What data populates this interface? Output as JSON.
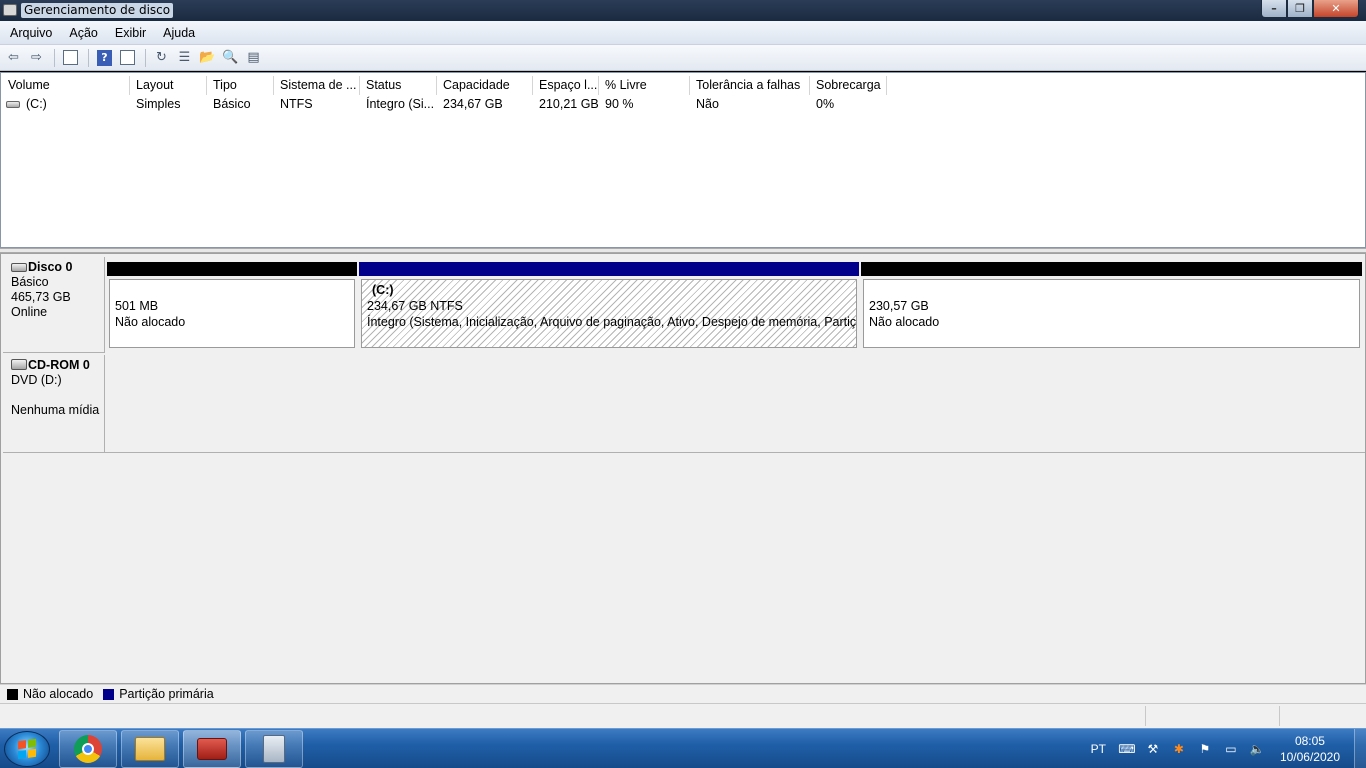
{
  "window": {
    "title": "Gerenciamento de disco",
    "min_glyph": "–",
    "max_glyph": "❐",
    "close_glyph": "✕"
  },
  "menu": [
    "Arquivo",
    "Ação",
    "Exibir",
    "Ajuda"
  ],
  "toolbar": {
    "back_icon": "back-arrow-icon",
    "forward_icon": "forward-arrow-icon",
    "back_glyph": "⇦",
    "forward_glyph": "⇨",
    "help_glyph": "?",
    "refresh_glyph": "↻",
    "props_glyph": "☰",
    "open_glyph": "📂",
    "search_glyph": "🔍",
    "report_glyph": "▤"
  },
  "columns": [
    "Volume",
    "Layout",
    "Tipo",
    "Sistema de ...",
    "Status",
    "Capacidade",
    "Espaço l...",
    "% Livre",
    "Tolerância a falhas",
    "Sobrecarga"
  ],
  "volumes": [
    {
      "volume": "(C:)",
      "layout": "Simples",
      "tipo": "Básico",
      "sistema": "NTFS",
      "status": "Íntegro (Si...",
      "capacidade": "234,67 GB",
      "espaco": "210,21 GB",
      "livre": "90 %",
      "tolerancia": "Não",
      "sobrecarga": "0%"
    }
  ],
  "disks": {
    "disk0": {
      "name": "Disco 0",
      "type": "Básico",
      "size": "465,73 GB",
      "status": "Online"
    },
    "cdrom0": {
      "name": "CD-ROM 0",
      "drive": "DVD (D:)",
      "media": "Nenhuma mídia"
    }
  },
  "partitions": [
    {
      "label": "",
      "size": "501 MB",
      "status": "Não alocado",
      "color": "#000000"
    },
    {
      "label": "(C:)",
      "size": "234,67 GB NTFS",
      "status": "Íntegro (Sistema, Inicialização, Arquivo de paginação, Ativo, Despejo de memória, Partição p",
      "color": "#00008b"
    },
    {
      "label": "",
      "size": "230,57 GB",
      "status": "Não alocado",
      "color": "#000000"
    }
  ],
  "legend": [
    {
      "label": "Não alocado",
      "color": "#000000"
    },
    {
      "label": "Partição primária",
      "color": "#00008b"
    }
  ],
  "taskbar": {
    "lang": "PT",
    "time": "08:05",
    "date": "10/06/2020",
    "apps": [
      "chrome-icon",
      "explorer-folder-icon",
      "toolbox-icon",
      "calculator-icon"
    ]
  },
  "tray": {
    "keyboard_glyph": "⌨",
    "network_glyph": "⚒",
    "avast_glyph": "✱",
    "flag_glyph": "⚑",
    "monitor_glyph": "▭",
    "volume_glyph": "🔈"
  }
}
